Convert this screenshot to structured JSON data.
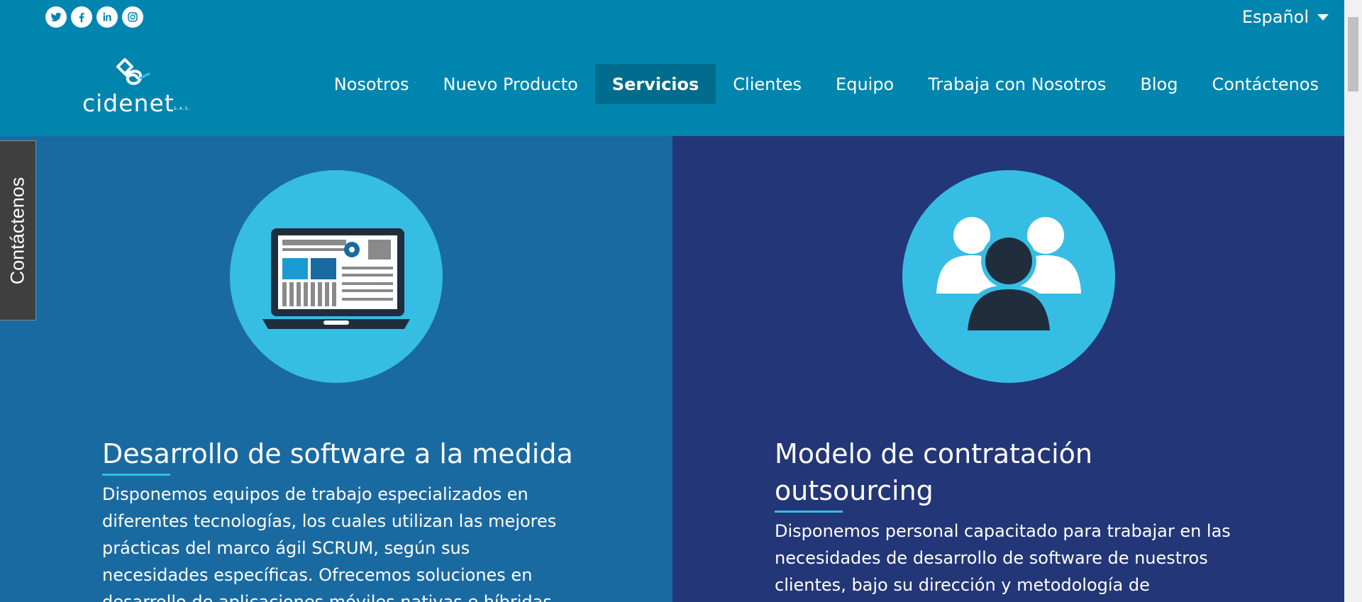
{
  "header": {
    "social": [
      {
        "name": "twitter-icon"
      },
      {
        "name": "facebook-icon"
      },
      {
        "name": "linkedin-icon"
      },
      {
        "name": "instagram-icon"
      }
    ],
    "language": "Español",
    "logo_text": "cidenet",
    "logo_suffix": "S.A.S.",
    "nav": [
      {
        "label": "Nosotros",
        "active": false
      },
      {
        "label": "Nuevo Producto",
        "active": false
      },
      {
        "label": "Servicios",
        "active": true
      },
      {
        "label": "Clientes",
        "active": false
      },
      {
        "label": "Equipo",
        "active": false
      },
      {
        "label": "Trabaja con Nosotros",
        "active": false
      },
      {
        "label": "Blog",
        "active": false
      },
      {
        "label": "Contáctenos",
        "active": false
      }
    ]
  },
  "services": [
    {
      "icon": "laptop-icon",
      "title": "Desarrollo de software a la medida",
      "description": "Disponemos equipos de trabajo especializados en diferentes tecnologías, los cuales utilizan las mejores prácticas del marco ágil SCRUM, según sus necesidades específicas. Ofrecemos soluciones en desarrollo de aplicaciones móviles nativas e híbridas"
    },
    {
      "icon": "team-icon",
      "title": "Modelo de contratación outsourcing",
      "description": "Disponemos personal capacitado para trabajar en las necesidades de desarrollo de software de nuestros clientes, bajo su dirección y metodología de"
    }
  ],
  "side_tab": "Contáctenos",
  "colors": {
    "header_bg": "#0085ae",
    "nav_active_bg": "#006c8d",
    "left_panel_bg": "#1a6aa2",
    "right_panel_bg": "#233677",
    "accent": "#36bde4",
    "side_tab_bg": "#3f3f3f"
  }
}
